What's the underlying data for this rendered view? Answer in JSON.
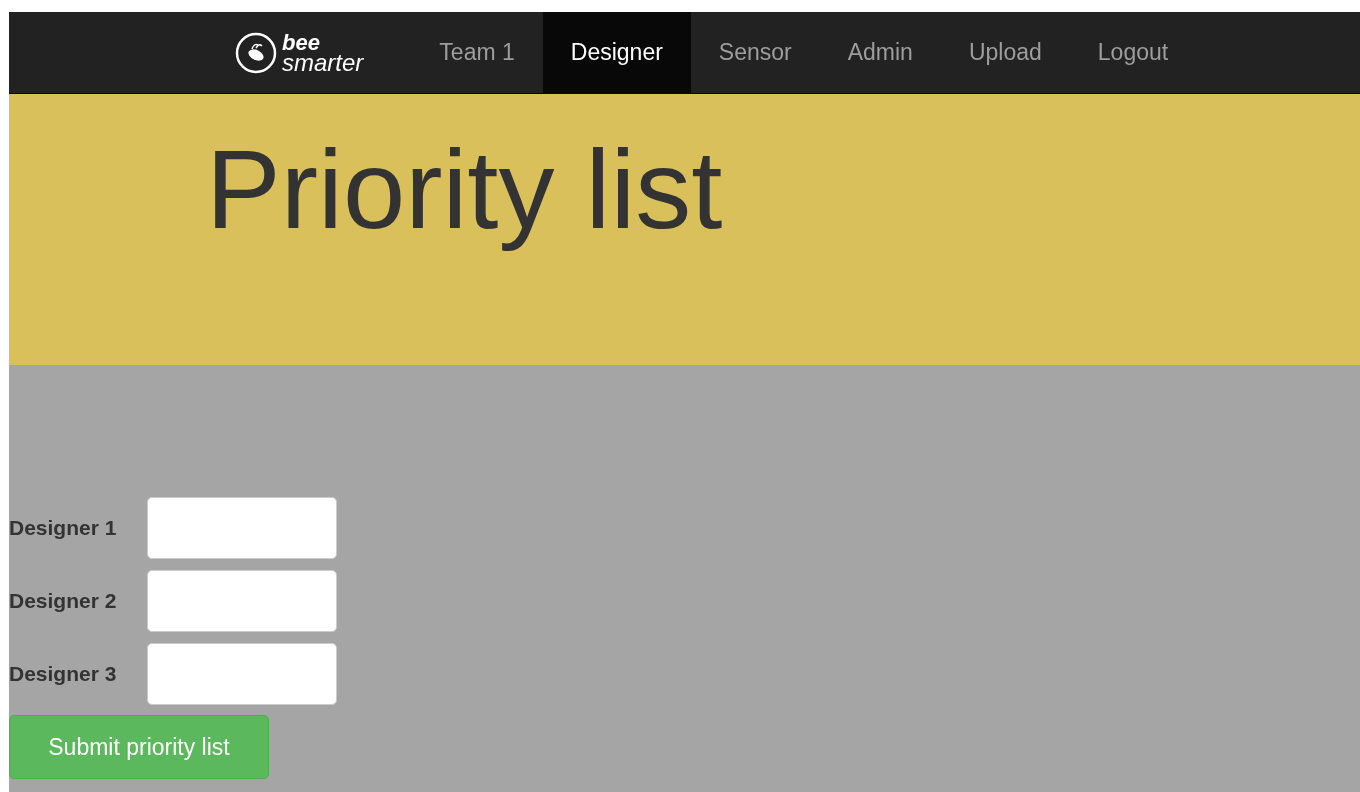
{
  "navbar": {
    "logo": {
      "line_1": "bee",
      "line_2": "smarter"
    },
    "items": [
      {
        "label": "Team 1",
        "selected": false
      },
      {
        "label": "Designer",
        "selected": true
      },
      {
        "label": "Sensor",
        "selected": false
      },
      {
        "label": "Admin",
        "selected": false
      },
      {
        "label": "Upload",
        "selected": false
      },
      {
        "label": "Logout",
        "selected": false
      }
    ]
  },
  "header": {
    "title": "Priority list"
  },
  "form": {
    "fields": [
      {
        "label": "Designer 1"
      },
      {
        "label": "Designer 2"
      },
      {
        "label": "Designer 3"
      }
    ],
    "submit": "Submit priority list"
  }
}
